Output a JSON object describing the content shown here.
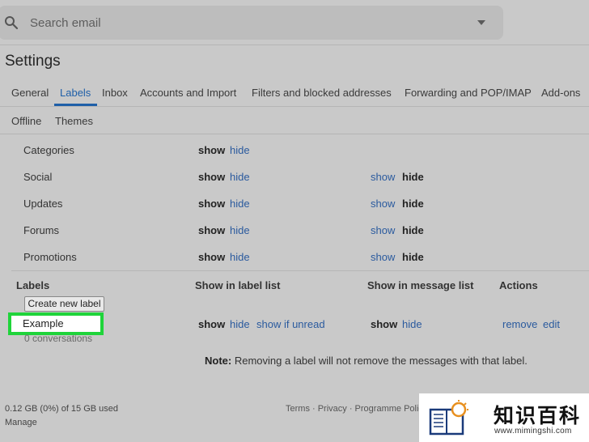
{
  "search": {
    "placeholder": "Search email"
  },
  "page_title": "Settings",
  "tabs": [
    {
      "label": "General"
    },
    {
      "label": "Labels"
    },
    {
      "label": "Inbox"
    },
    {
      "label": "Accounts and Import"
    },
    {
      "label": "Filters and blocked addresses"
    },
    {
      "label": "Forwarding and POP/IMAP"
    },
    {
      "label": "Add-ons"
    },
    {
      "label": "Offline"
    },
    {
      "label": "Themes"
    }
  ],
  "active_tab": "Labels",
  "categories": [
    {
      "name": "Categories",
      "show": "show",
      "hide": "hide"
    },
    {
      "name": "Social",
      "show": "show",
      "hide": "hide",
      "msg_show": "show",
      "msg_hide": "hide"
    },
    {
      "name": "Updates",
      "show": "show",
      "hide": "hide",
      "msg_show": "show",
      "msg_hide": "hide"
    },
    {
      "name": "Forums",
      "show": "show",
      "hide": "hide",
      "msg_show": "show",
      "msg_hide": "hide"
    },
    {
      "name": "Promotions",
      "show": "show",
      "hide": "hide",
      "msg_show": "show",
      "msg_hide": "hide"
    }
  ],
  "labels_section": {
    "col_labels": "Labels",
    "col_label_list": "Show in label list",
    "col_message_list": "Show in message list",
    "col_actions": "Actions",
    "create_button": "Create new label",
    "label": {
      "name": "Example",
      "count": "0 conversations",
      "show": "show",
      "hide": "hide",
      "show_if_unread": "show if unread",
      "msg_show": "show",
      "msg_hide": "hide",
      "remove": "remove",
      "edit": "edit"
    }
  },
  "note": {
    "bold": "Note:",
    "text": " Removing a label will not remove the messages with that label."
  },
  "footer": {
    "storage": "0.12 GB (0%) of 15 GB used",
    "manage": "Manage",
    "links": "Terms · Privacy · Programme Policies"
  },
  "watermark": {
    "title": "知识百科",
    "url": "www.mimingshi.com"
  },
  "colors": {
    "accent": "#1f5fa8",
    "highlight": "#1fd43a",
    "background": "#c9c9c9"
  }
}
